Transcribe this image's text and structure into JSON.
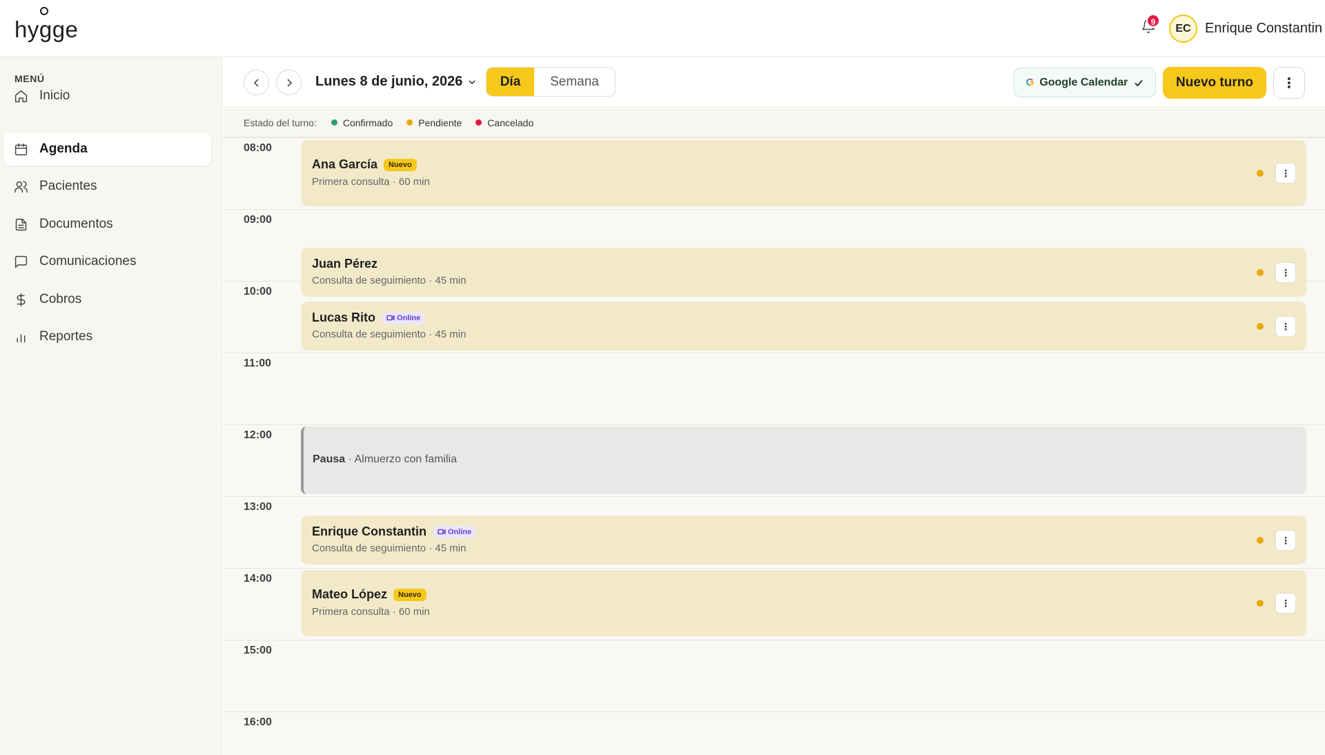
{
  "app": {
    "logo_text": "hygge"
  },
  "header": {
    "notifications_count": "9",
    "user_initials": "EC",
    "user_name": "Enrique Constantin"
  },
  "sidebar": {
    "menu_title": "MENÚ",
    "items": [
      {
        "label": "Inicio",
        "icon": "home-icon"
      },
      {
        "label": "Agenda",
        "icon": "calendar-icon",
        "active": true
      },
      {
        "label": "Pacientes",
        "icon": "users-icon"
      },
      {
        "label": "Documentos",
        "icon": "document-icon"
      },
      {
        "label": "Comunicaciones",
        "icon": "message-icon"
      },
      {
        "label": "Cobros",
        "icon": "dollar-icon"
      },
      {
        "label": "Reportes",
        "icon": "bar-chart-icon"
      }
    ]
  },
  "toolbar": {
    "date_label": "Lunes 8 de junio, 2026",
    "view_day": "Día",
    "view_week": "Semana",
    "active_view": "Día",
    "google_calendar_label": "Google Calendar",
    "new_appointment_label": "Nuevo turno"
  },
  "legend": {
    "title": "Estado del turno:",
    "items": [
      {
        "label": "Confirmado",
        "color": "#2e9e6b"
      },
      {
        "label": "Pendiente",
        "color": "#e9a90b"
      },
      {
        "label": "Cancelado",
        "color": "#e5173f"
      }
    ]
  },
  "calendar": {
    "hours": [
      "08:00",
      "09:00",
      "10:00",
      "11:00",
      "12:00",
      "13:00",
      "14:00",
      "15:00",
      "16:00"
    ],
    "appointments": [
      {
        "name": "Ana García",
        "badge": "Nuevo",
        "detail": "Primera consulta · 60 min",
        "status": "Pendiente"
      },
      {
        "name": "Juan Pérez",
        "badge": "",
        "detail": "Consulta de seguimiento · 45 min",
        "status": "Pendiente"
      },
      {
        "name": "Lucas Rito",
        "badge": "Online",
        "detail": "Consulta de seguimiento · 45 min",
        "status": "Pendiente"
      },
      {
        "name": "Enrique Constantin",
        "badge": "Online",
        "detail": "Consulta de seguimiento · 45 min",
        "status": "Pendiente"
      },
      {
        "name": "Mateo López",
        "badge": "Nuevo",
        "detail": "Primera consulta · 60 min",
        "status": "Pendiente"
      }
    ],
    "pause": {
      "title": "Pausa",
      "detail": "· Almuerzo con familia"
    }
  }
}
